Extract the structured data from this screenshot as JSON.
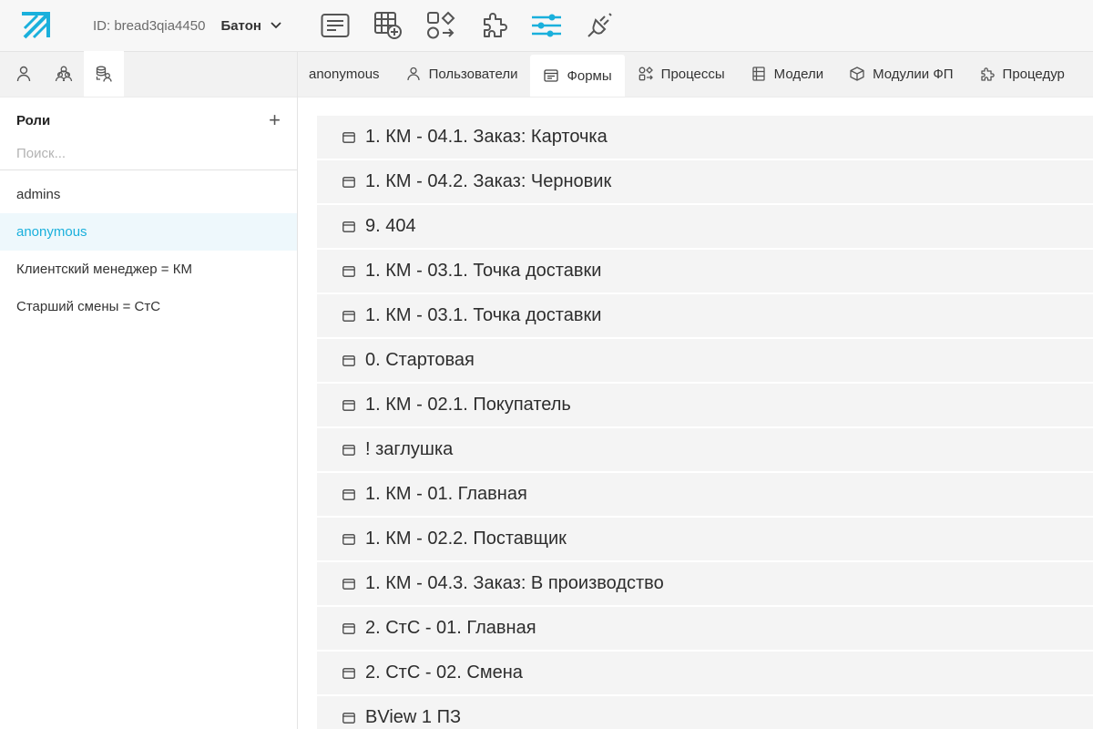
{
  "topbar": {
    "project_id": "ID: bread3qia4450",
    "project_name": "Батон",
    "accent": "#1ab0dc",
    "tools": [
      {
        "icon": "form-editor-icon"
      },
      {
        "icon": "table-add-icon"
      },
      {
        "icon": "process-shapes-icon"
      },
      {
        "icon": "puzzle-icon"
      },
      {
        "icon": "sliders-icon",
        "active": true
      },
      {
        "icon": "plug-icon"
      }
    ]
  },
  "left": {
    "tabs": [
      {
        "icon": "user-icon"
      },
      {
        "icon": "users-group-icon"
      },
      {
        "icon": "roles-icon",
        "active": true
      }
    ],
    "title": "Роли",
    "add_label": "+",
    "search_placeholder": "Поиск...",
    "roles": [
      {
        "label": "admins"
      },
      {
        "label": "anonymous",
        "active": true
      },
      {
        "label": "Клиентский менеджер = КМ"
      },
      {
        "label": "Старший смены = СтС"
      }
    ]
  },
  "tabs": [
    {
      "label": "anonymous",
      "icon": ""
    },
    {
      "label": "Пользователи",
      "icon": "user-icon"
    },
    {
      "label": "Формы",
      "icon": "form-icon",
      "active": true
    },
    {
      "label": "Процессы",
      "icon": "process-icon"
    },
    {
      "label": "Модели",
      "icon": "model-icon"
    },
    {
      "label": "Модулии ФП",
      "icon": "cube-icon"
    },
    {
      "label": "Процедур",
      "icon": "puzzle-icon"
    }
  ],
  "forms": [
    "1. КМ - 04.1. Заказ: Карточка",
    "1. КМ - 04.2. Заказ: Черновик",
    "9. 404",
    "1. КМ - 03.1. Точка доставки",
    "1. КМ - 03.1. Точка доставки",
    "0. Стартовая",
    "1. КМ - 02.1. Покупатель",
    "! заглушка",
    "1. КМ - 01. Главная",
    "1. КМ - 02.2. Поставщик",
    "1. КМ - 04.3. Заказ: В производство",
    "2. СтС - 01. Главная",
    "2. СтС - 02. Смена",
    "BView 1 ПЗ"
  ]
}
